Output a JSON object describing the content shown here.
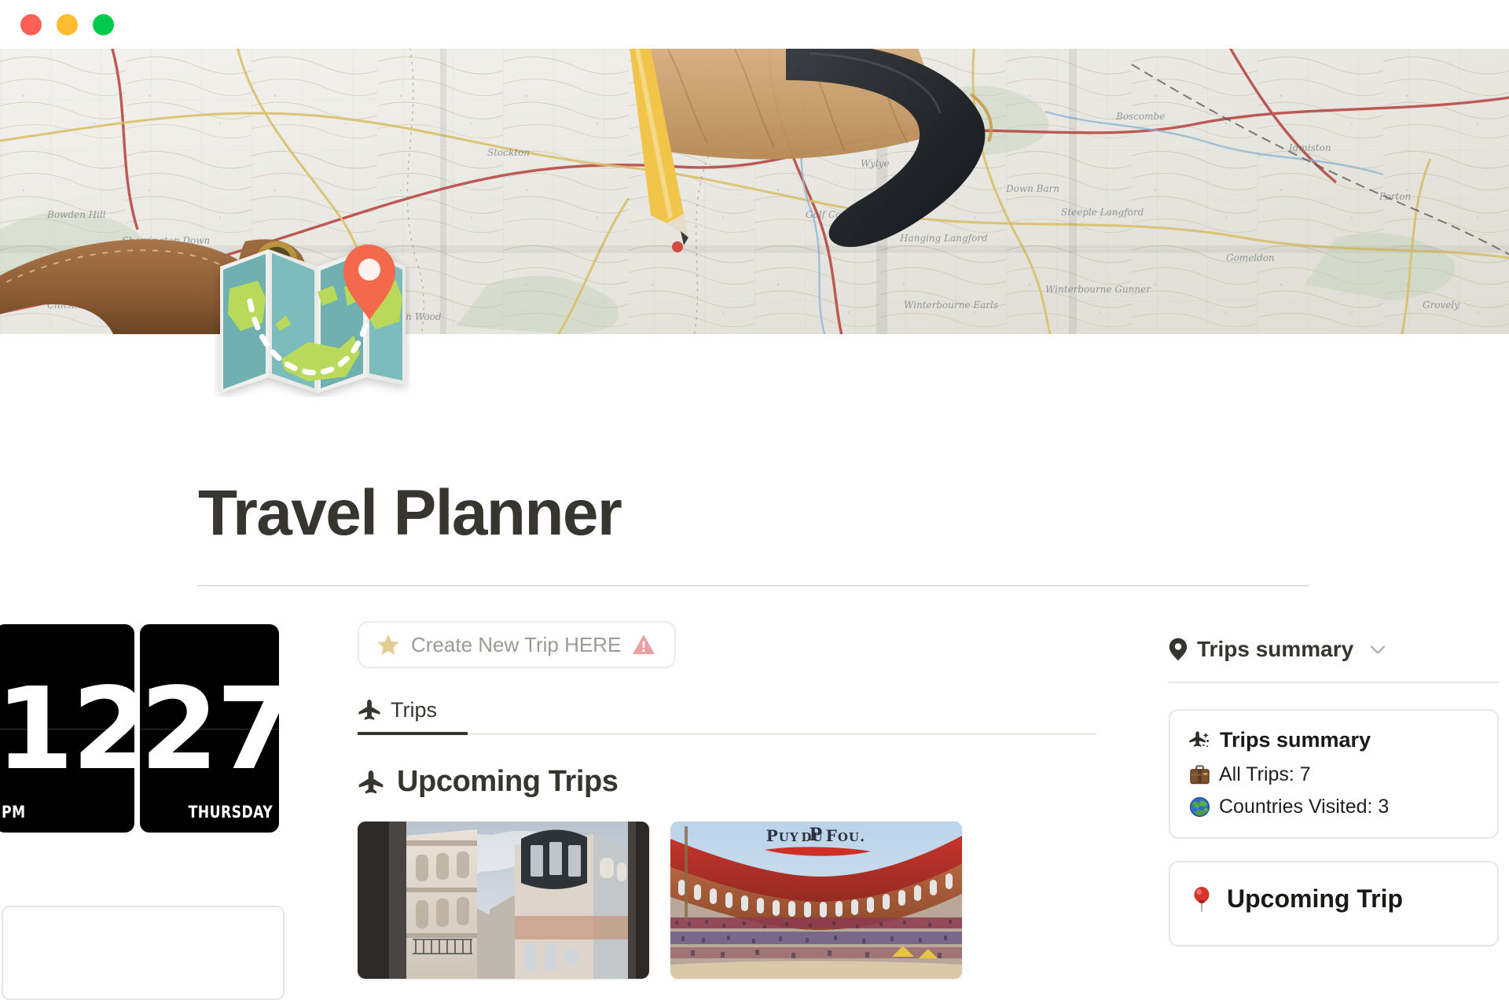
{
  "window": {
    "controls": [
      "close",
      "minimize",
      "maximize"
    ],
    "colors": {
      "close": "#ff5f57",
      "minimize": "#febc2e",
      "maximize": "#00ca4e"
    }
  },
  "cover": {
    "alt": "Folded Ordnance Survey topographic map with leather bag strap and dark camera strap"
  },
  "page": {
    "icon": "world-map-emoji",
    "title": "Travel Planner"
  },
  "clock": {
    "hour": "12",
    "meridiem": "PM",
    "day_number": "27",
    "weekday": "THURSDAY"
  },
  "main": {
    "create_button": {
      "star_icon": "star-emoji",
      "label": "Create New Trip HERE",
      "warning_icon": "warning-triangle-emoji"
    },
    "tabs": [
      {
        "icon": "airplane-icon",
        "label": "Trips",
        "active": true
      }
    ],
    "section": {
      "icon": "airplane-icon",
      "title": "Upcoming Trips"
    },
    "trip_cards": [
      {
        "name": "paris-street-photo",
        "caption": ""
      },
      {
        "name": "puy-du-fou-arena-photo",
        "caption": "PUY DU FOU."
      }
    ]
  },
  "sidebar": {
    "header": {
      "icon": "map-pin-icon",
      "label": "Trips summary",
      "chevron": "chevron-down-icon"
    },
    "summary_card": {
      "icon": "airplane-sparkle-emoji",
      "title": "Trips summary",
      "rows": [
        {
          "icon": "suitcase-emoji",
          "text": "All Trips: 7"
        },
        {
          "icon": "earth-globe-emoji",
          "text": "Countries Visited: 3"
        }
      ]
    },
    "upcoming_card": {
      "icon": "pushpin-emoji",
      "title": "Upcoming Trip"
    }
  },
  "colors": {
    "text_primary": "#37352f",
    "text_muted": "#9b9a97",
    "border": "#e7e6e4",
    "star": "#e8d29a",
    "warning": "#e8a0a0",
    "accent_pin": "#f4694c"
  }
}
